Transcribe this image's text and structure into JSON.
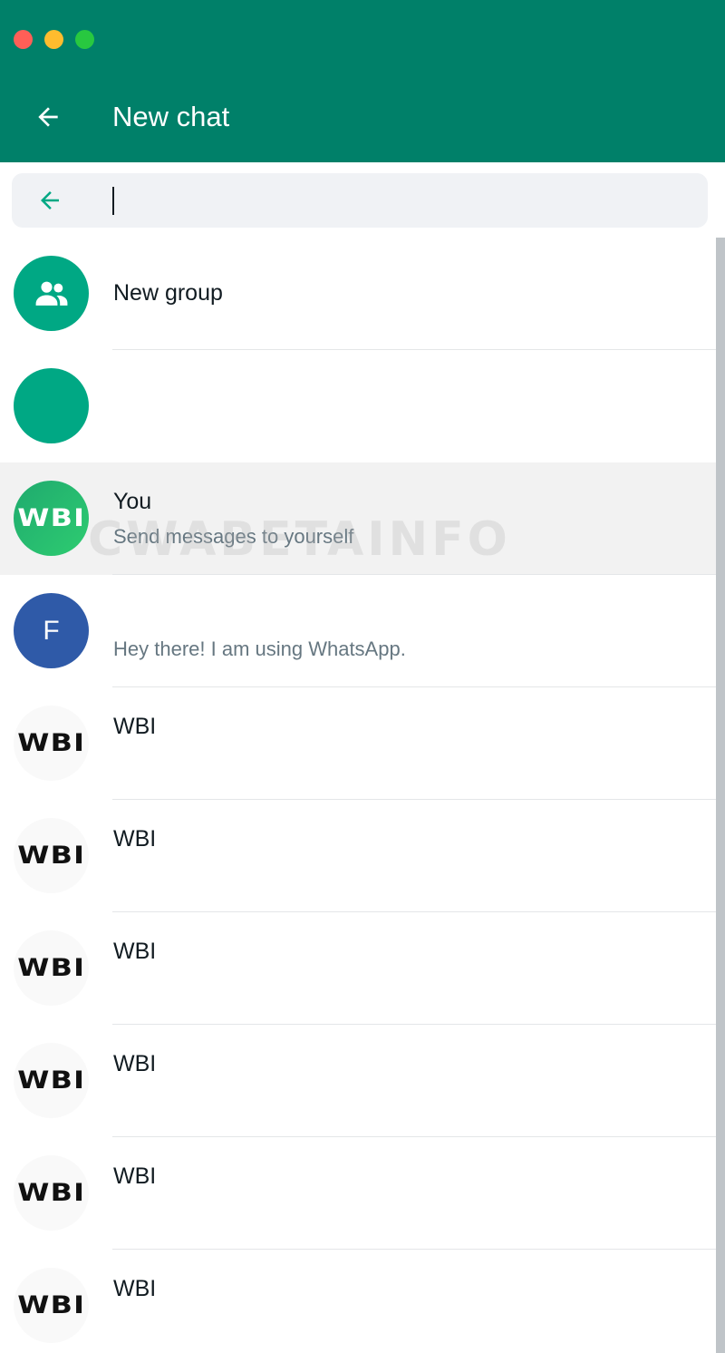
{
  "window": {
    "controls": [
      "close",
      "minimize",
      "zoom"
    ]
  },
  "header": {
    "title": "New chat",
    "back_icon": "arrow-left-icon"
  },
  "search": {
    "value": "",
    "back_icon": "arrow-left-icon"
  },
  "colors": {
    "header_bg": "#008069",
    "accent": "#00a884",
    "selected_row_bg": "#f2f2f2"
  },
  "rows": {
    "new_group": {
      "label": "New group",
      "icon": "group-icon"
    },
    "blank": {
      "label": ""
    },
    "you": {
      "name": "You",
      "status": "Send messages to yourself",
      "avatar_text": "WBI"
    },
    "contact_f": {
      "name": "",
      "status": "Hey there! I am using WhatsApp.",
      "avatar_letter": "F"
    },
    "wbi_contacts": [
      {
        "name": "WBI",
        "avatar_text": "WBI"
      },
      {
        "name": "WBI",
        "avatar_text": "WBI"
      },
      {
        "name": "WBI",
        "avatar_text": "WBI"
      },
      {
        "name": "WBI",
        "avatar_text": "WBI"
      },
      {
        "name": "WBI",
        "avatar_text": "WBI"
      },
      {
        "name": "WBI",
        "avatar_text": "WBI"
      }
    ]
  },
  "watermark": "CWABETAINFO"
}
